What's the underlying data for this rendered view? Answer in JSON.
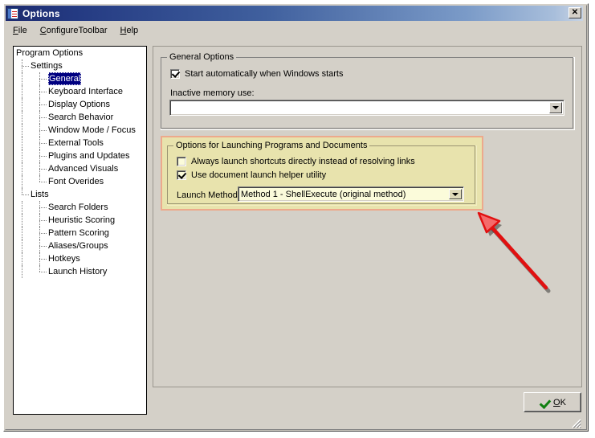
{
  "window": {
    "title": "Options",
    "icon": "options-checklist-icon",
    "close_label": "✕"
  },
  "menubar": {
    "items": [
      {
        "label": "File",
        "accel": "F"
      },
      {
        "label": "ConfigureToolbar",
        "accel": "C"
      },
      {
        "label": "Help",
        "accel": "H"
      }
    ]
  },
  "tree": {
    "nodes": [
      {
        "label": "Program Options",
        "level": 0,
        "selected": false
      },
      {
        "label": "Settings",
        "level": 1,
        "selected": false
      },
      {
        "label": "General",
        "level": 2,
        "selected": true
      },
      {
        "label": "Keyboard Interface",
        "level": 2,
        "selected": false
      },
      {
        "label": "Display Options",
        "level": 2,
        "selected": false
      },
      {
        "label": "Search Behavior",
        "level": 2,
        "selected": false
      },
      {
        "label": "Window Mode / Focus",
        "level": 2,
        "selected": false
      },
      {
        "label": "External Tools",
        "level": 2,
        "selected": false
      },
      {
        "label": "Plugins and Updates",
        "level": 2,
        "selected": false
      },
      {
        "label": "Advanced Visuals",
        "level": 2,
        "selected": false
      },
      {
        "label": "Font Overides",
        "level": 2,
        "selected": false
      },
      {
        "label": "Lists",
        "level": 1,
        "selected": false
      },
      {
        "label": "Search Folders",
        "level": 2,
        "selected": false
      },
      {
        "label": "Heuristic Scoring",
        "level": 2,
        "selected": false
      },
      {
        "label": "Pattern Scoring",
        "level": 2,
        "selected": false
      },
      {
        "label": "Aliases/Groups",
        "level": 2,
        "selected": false
      },
      {
        "label": "Hotkeys",
        "level": 2,
        "selected": false
      },
      {
        "label": "Launch History",
        "level": 2,
        "selected": false
      }
    ]
  },
  "general_group": {
    "title": "General Options",
    "startup_checkbox": {
      "label": "Start automatically when Windows starts",
      "checked": true
    },
    "memory_label": "Inactive memory use:",
    "memory_combo_value": ""
  },
  "launch_panel": {
    "title": "Options for Launching Programs and Documents",
    "highlight_fill": "#e8e3ad",
    "highlight_border": "#eda98c",
    "always_launch_checkbox": {
      "label": "Always launch shortcuts directly instead of resolving links",
      "checked": false
    },
    "helper_checkbox": {
      "label": "Use document launch helper utility",
      "checked": true
    },
    "launch_method_label": "Launch Method:",
    "launch_method_value": "Method 1 - ShellExecute (original method)"
  },
  "buttons": {
    "ok_label": "OK",
    "ok_accel": "O"
  },
  "annotation": {
    "arrow_color": "#e11010",
    "arrow_shadow": "rgba(0,0,0,0.45)"
  }
}
